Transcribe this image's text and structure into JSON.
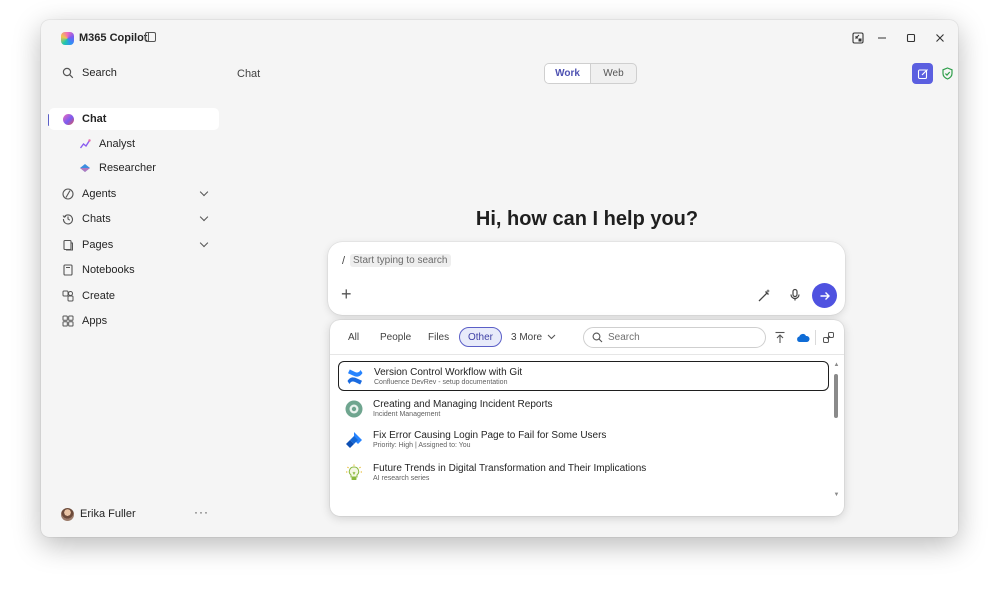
{
  "app": {
    "title": "M365 Copilot"
  },
  "sidebar": {
    "items": [
      {
        "label": "Search"
      },
      {
        "label": "Chat"
      },
      {
        "label": "Analyst"
      },
      {
        "label": "Researcher"
      },
      {
        "label": "Agents"
      },
      {
        "label": "Chats"
      },
      {
        "label": "Pages"
      },
      {
        "label": "Notebooks"
      },
      {
        "label": "Create"
      },
      {
        "label": "Apps"
      }
    ],
    "user": {
      "name": "Erika Fuller",
      "more": "···"
    }
  },
  "main": {
    "breadcrumb": "Chat",
    "mode": {
      "options": [
        "Work",
        "Web"
      ],
      "selected": "Work"
    },
    "greeting": "Hi, how can I help you?",
    "composer": {
      "slash": "/",
      "hint": "Start typing to search",
      "add": "+"
    },
    "picker": {
      "tabs": [
        "All",
        "People",
        "Files",
        "Other",
        "3 More"
      ],
      "selected_tab": "Other",
      "search_placeholder": "Search",
      "results": [
        {
          "title": "Version Control Workflow with Git",
          "subtitle": "Confluence DevRev - setup documentation",
          "icon": "confluence-icon"
        },
        {
          "title": "Creating and Managing Incident Reports",
          "subtitle": "Incident Management",
          "icon": "incident-icon"
        },
        {
          "title": "Fix Error Causing Login Page to Fail for Some Users",
          "subtitle": "Priority: High | Assigned to: You",
          "icon": "jira-icon"
        },
        {
          "title": "Future Trends in Digital Transformation and Their Implications",
          "subtitle": "AI research series",
          "icon": "lightbulb-icon"
        }
      ]
    }
  },
  "colors": {
    "accent": "#5b5fc7",
    "send": "#4f52e0",
    "shield": "#2e9e4a"
  }
}
